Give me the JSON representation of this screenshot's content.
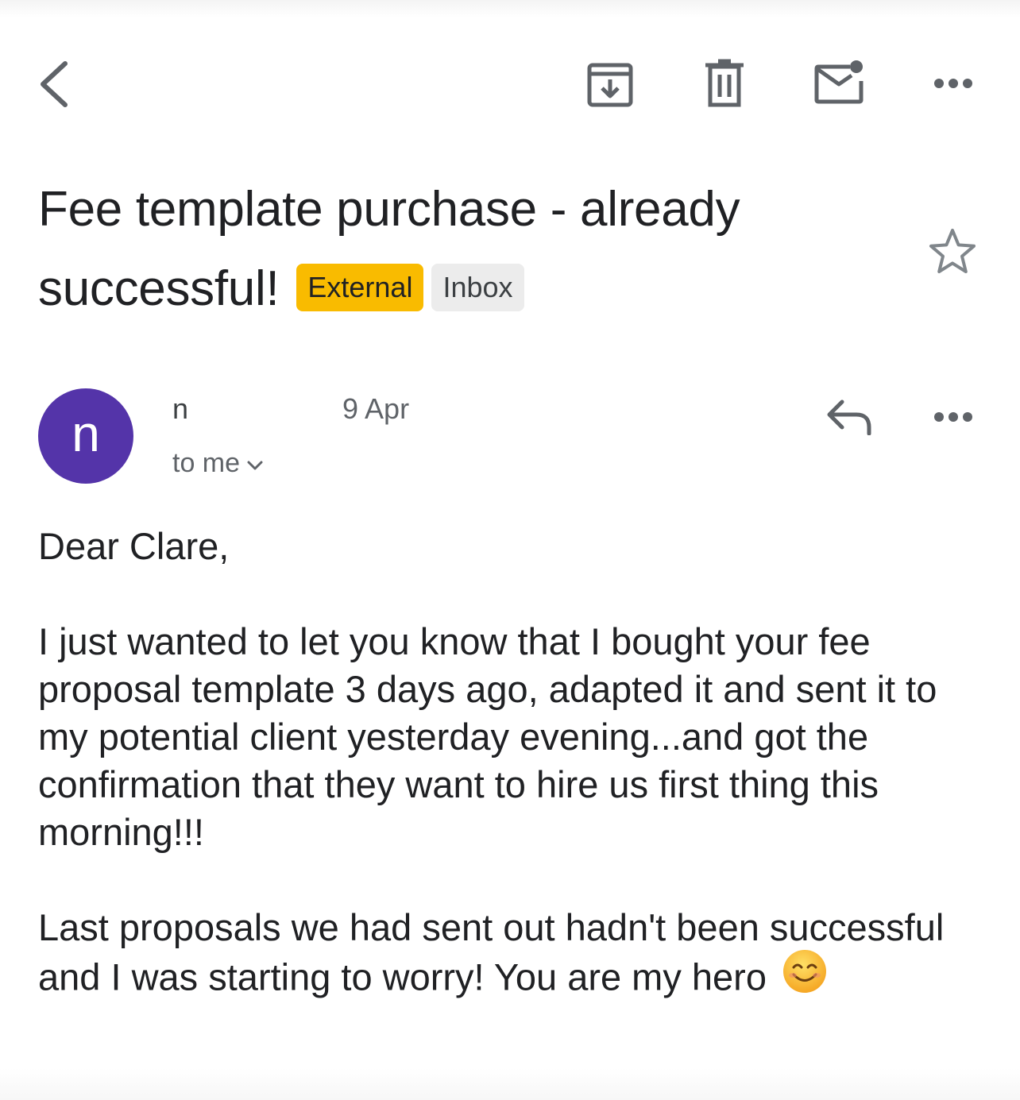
{
  "toolbar": {
    "icons": [
      "back-arrow-icon",
      "archive-icon",
      "delete-icon",
      "mark-unread-icon",
      "more-options-icon"
    ]
  },
  "email": {
    "subject": "Fee template purchase - already successful!",
    "labels": {
      "external": "External",
      "inbox": "Inbox"
    },
    "starred": false,
    "sender": {
      "avatar_letter": "n",
      "avatar_color": "#5434a9",
      "name_visible": "n",
      "date": "9 Apr",
      "recipient": "to me"
    },
    "body": {
      "greeting": "Dear Clare,",
      "paragraph1": "I just wanted to let you know that I bought your fee proposal template 3 days ago, adapted it and sent it to my potential client yesterday evening...and got the confirmation that they want to hire us first thing this morning!!!",
      "paragraph2": "Last proposals we had sent out hadn't been successful and I was starting to worry! You are my hero",
      "emoji": "smiling-face-icon"
    }
  },
  "colors": {
    "external_chip": "#f9bb00",
    "inbox_chip": "#ececec",
    "icon_gray": "#5f6368"
  }
}
